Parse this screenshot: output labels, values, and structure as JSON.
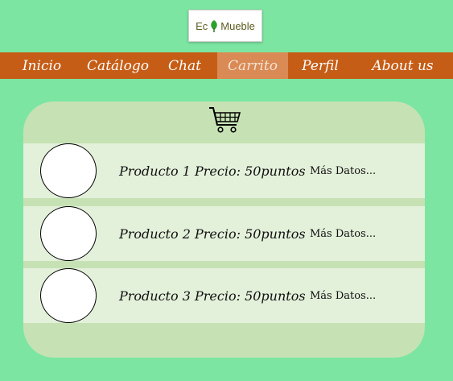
{
  "logo": {
    "text_left": "Ec",
    "text_right": "Mueble"
  },
  "nav": {
    "items": [
      {
        "label": "Inicio"
      },
      {
        "label": "Catálogo"
      },
      {
        "label": "Chat"
      },
      {
        "label": "Carrito"
      },
      {
        "label": "Perfil"
      },
      {
        "label": "About us"
      }
    ],
    "active": "Carrito"
  },
  "cart": {
    "icon": "shopping-cart-icon"
  },
  "products": [
    {
      "name": "Producto 1",
      "price": "Precio: 50puntos",
      "more": "Más Datos..."
    },
    {
      "name": "Producto 2",
      "price": "Precio: 50puntos",
      "more": "Más Datos..."
    },
    {
      "name": "Producto 3",
      "price": "Precio: 50puntos",
      "more": "Más Datos..."
    }
  ],
  "colors": {
    "background": "#7de5a2",
    "nav": "#c65d16",
    "nav_active": "#d98a55",
    "panel": "#c6e2b4",
    "row": "#e3f0da"
  }
}
